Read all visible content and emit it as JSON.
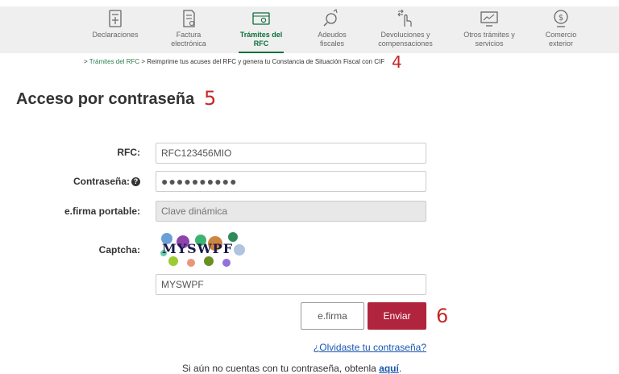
{
  "nav": {
    "items": [
      {
        "label": "Declaraciones",
        "icon": "calculator-icon"
      },
      {
        "label": "Factura electrónica",
        "icon": "invoice-icon"
      },
      {
        "label": "Trámites del RFC",
        "icon": "id-card-icon",
        "active": true
      },
      {
        "label": "Adeudos fiscales",
        "icon": "search-coin-icon"
      },
      {
        "label": "Devoluciones y compensaciones",
        "icon": "hand-arrows-icon"
      },
      {
        "label": "Otros trámites y servicios",
        "icon": "monitor-chart-icon"
      },
      {
        "label": "Comercio exterior",
        "icon": "globe-dollar-icon"
      }
    ]
  },
  "breadcrumb": {
    "separator": ">",
    "link": "Trámites del RFC",
    "current": "Reimprime tus acuses del RFC y genera tu Constancia de Situación Fiscal con CIF"
  },
  "markers": {
    "m4": "4",
    "m5": "5",
    "m6": "6"
  },
  "page_title": "Acceso por contraseña",
  "form": {
    "rfc_label": "RFC:",
    "rfc_value": "RFC123456MIO",
    "password_label": "Contraseña:",
    "password_help": "?",
    "password_value": "●●●●●●●●●●",
    "efirma_label": "e.firma portable:",
    "efirma_placeholder": "Clave dinámica",
    "captcha_label": "Captcha:",
    "captcha_text": "MYSWPF",
    "captcha_value": "MYSWPF"
  },
  "buttons": {
    "efirma": "e.firma",
    "enviar": "Enviar"
  },
  "links": {
    "forgot": "¿Olvidaste tu contraseña?",
    "signup_prefix": "Si aún no cuentas con tu contraseña, obtenla ",
    "signup_link": "aquí",
    "signup_suffix": "."
  },
  "colors": {
    "accent_green": "#0b6e3a",
    "primary_button": "#b0243d",
    "link": "#1a56b0",
    "marker": "#c62828"
  }
}
